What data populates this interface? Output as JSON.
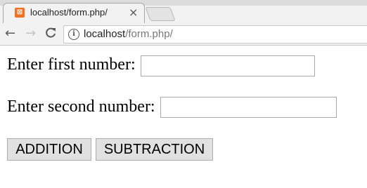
{
  "browser": {
    "tab": {
      "title": "localhost/form.php/",
      "close_glyph": "×",
      "favicon": "xampp-icon"
    },
    "toolbar": {
      "back_glyph": "←",
      "forward_glyph": "→",
      "reload_glyph": "C",
      "info_glyph": "i",
      "url_host": "localhost",
      "url_path": "/form.php/"
    }
  },
  "form": {
    "first_label": "Enter first number:",
    "first_value": "",
    "second_label": "Enter second number:",
    "second_value": "",
    "addition_label": "ADDITION",
    "subtraction_label": "SUBTRACTION"
  },
  "colors": {
    "favicon": "#f36f21",
    "chrome_bg": "#f2f2f2",
    "button_bg": "#e1e1e1"
  }
}
